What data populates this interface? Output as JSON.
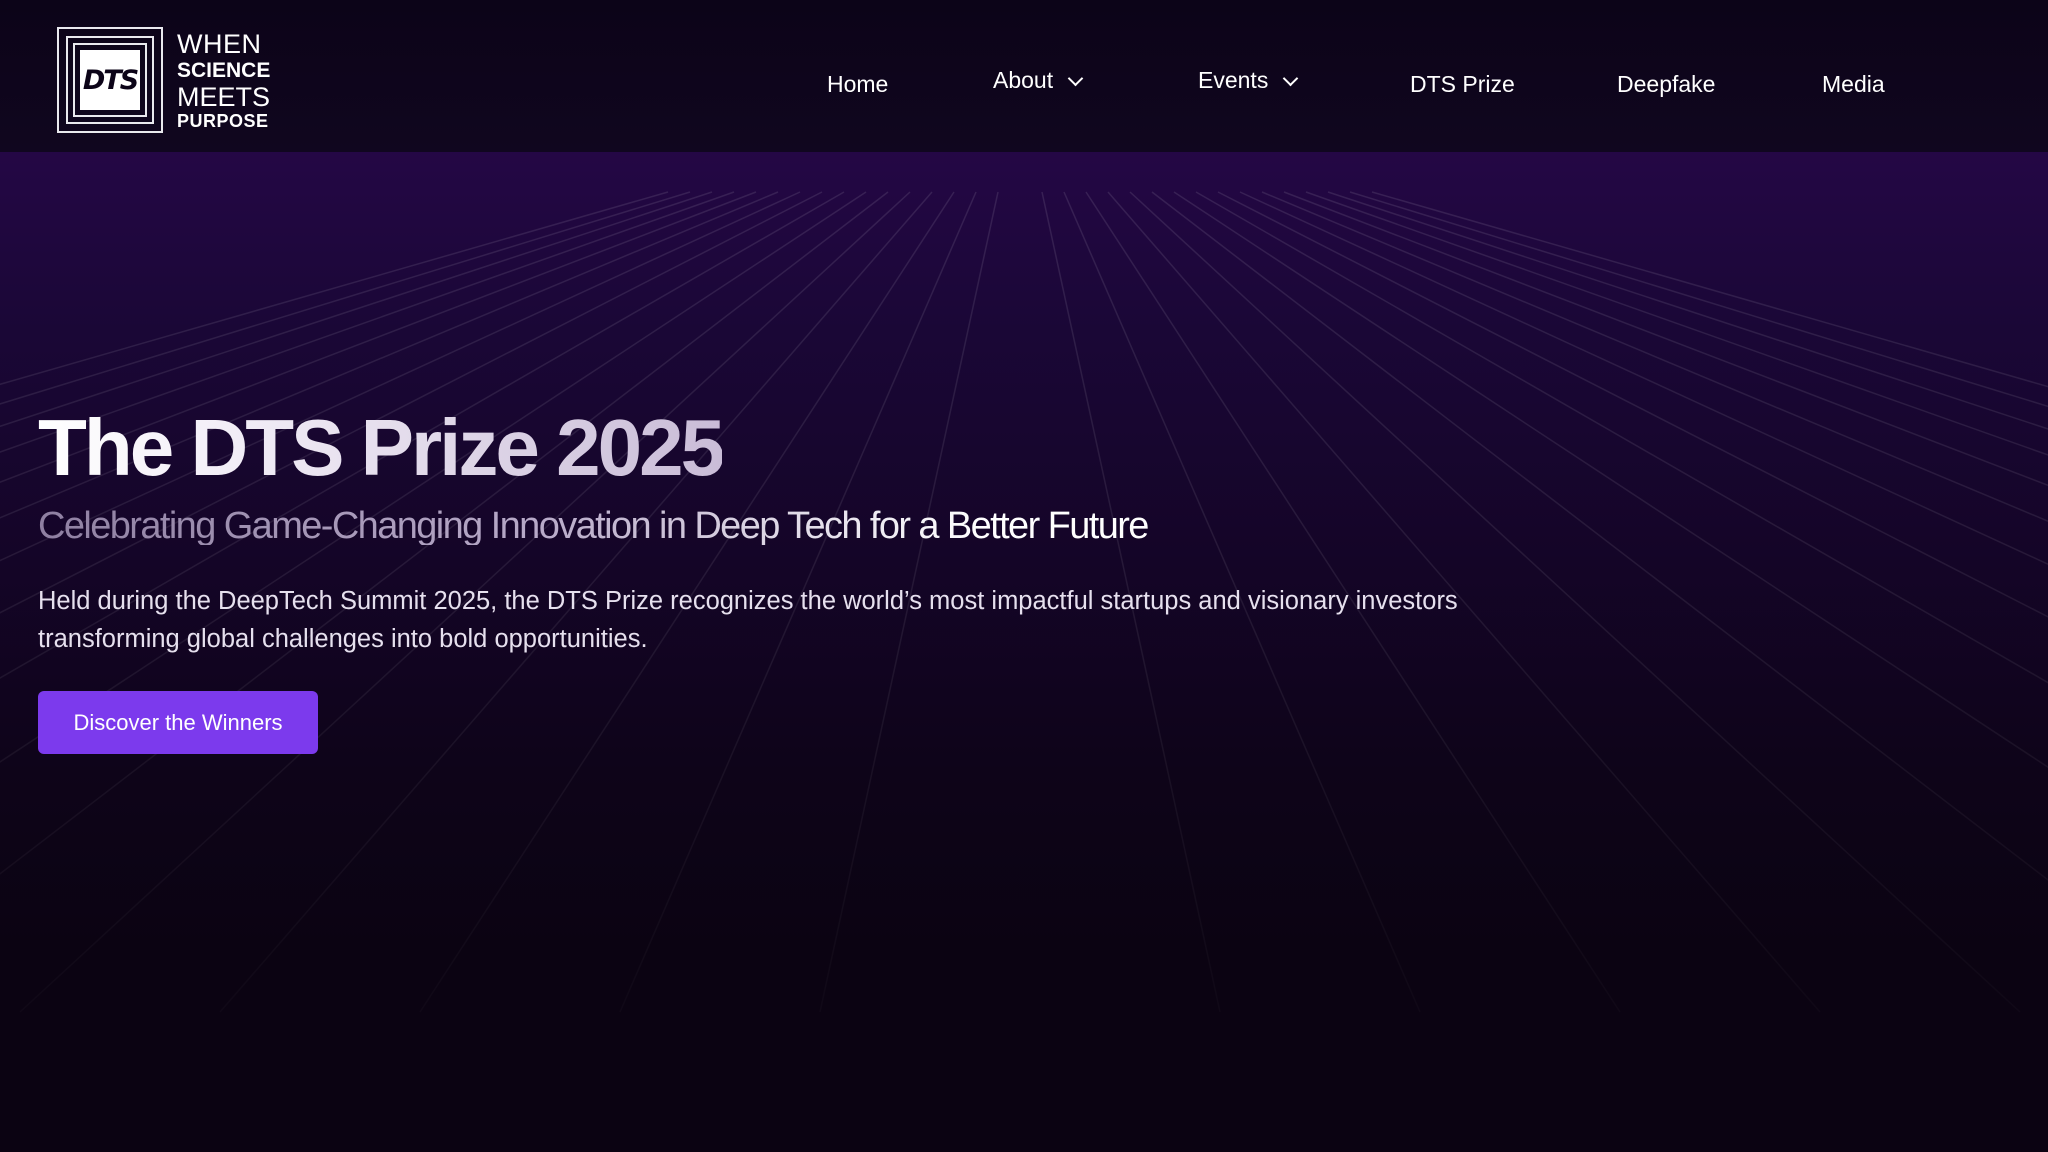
{
  "logo": {
    "mark_text": "DTS",
    "line1": "WHEN",
    "line2": "SCIENCE",
    "line3": "MEETS",
    "line4": "PURPOSE"
  },
  "nav": {
    "items": [
      {
        "label": "Home",
        "has_dropdown": false
      },
      {
        "label": "About",
        "has_dropdown": true
      },
      {
        "label": "Events",
        "has_dropdown": true
      },
      {
        "label": "DTS Prize",
        "has_dropdown": false
      },
      {
        "label": "Deepfake",
        "has_dropdown": false
      },
      {
        "label": "Media",
        "has_dropdown": false
      }
    ]
  },
  "hero": {
    "title": "The DTS Prize 2025",
    "subtitle": "Celebrating Game-Changing Innovation in Deep Tech for a Better Future",
    "description": "Held during the DeepTech Summit 2025, the DTS Prize recognizes the world’s most impactful startups and visionary investors transforming global challenges into bold opportunities.",
    "cta_label": "Discover the Winners"
  },
  "colors": {
    "background": "#0b0312",
    "header": "#0c0418",
    "hero_top": "#240745",
    "accent": "#7c3aed",
    "text": "#ffffff"
  },
  "icons": {
    "dropdown": "chevron-down-icon"
  }
}
